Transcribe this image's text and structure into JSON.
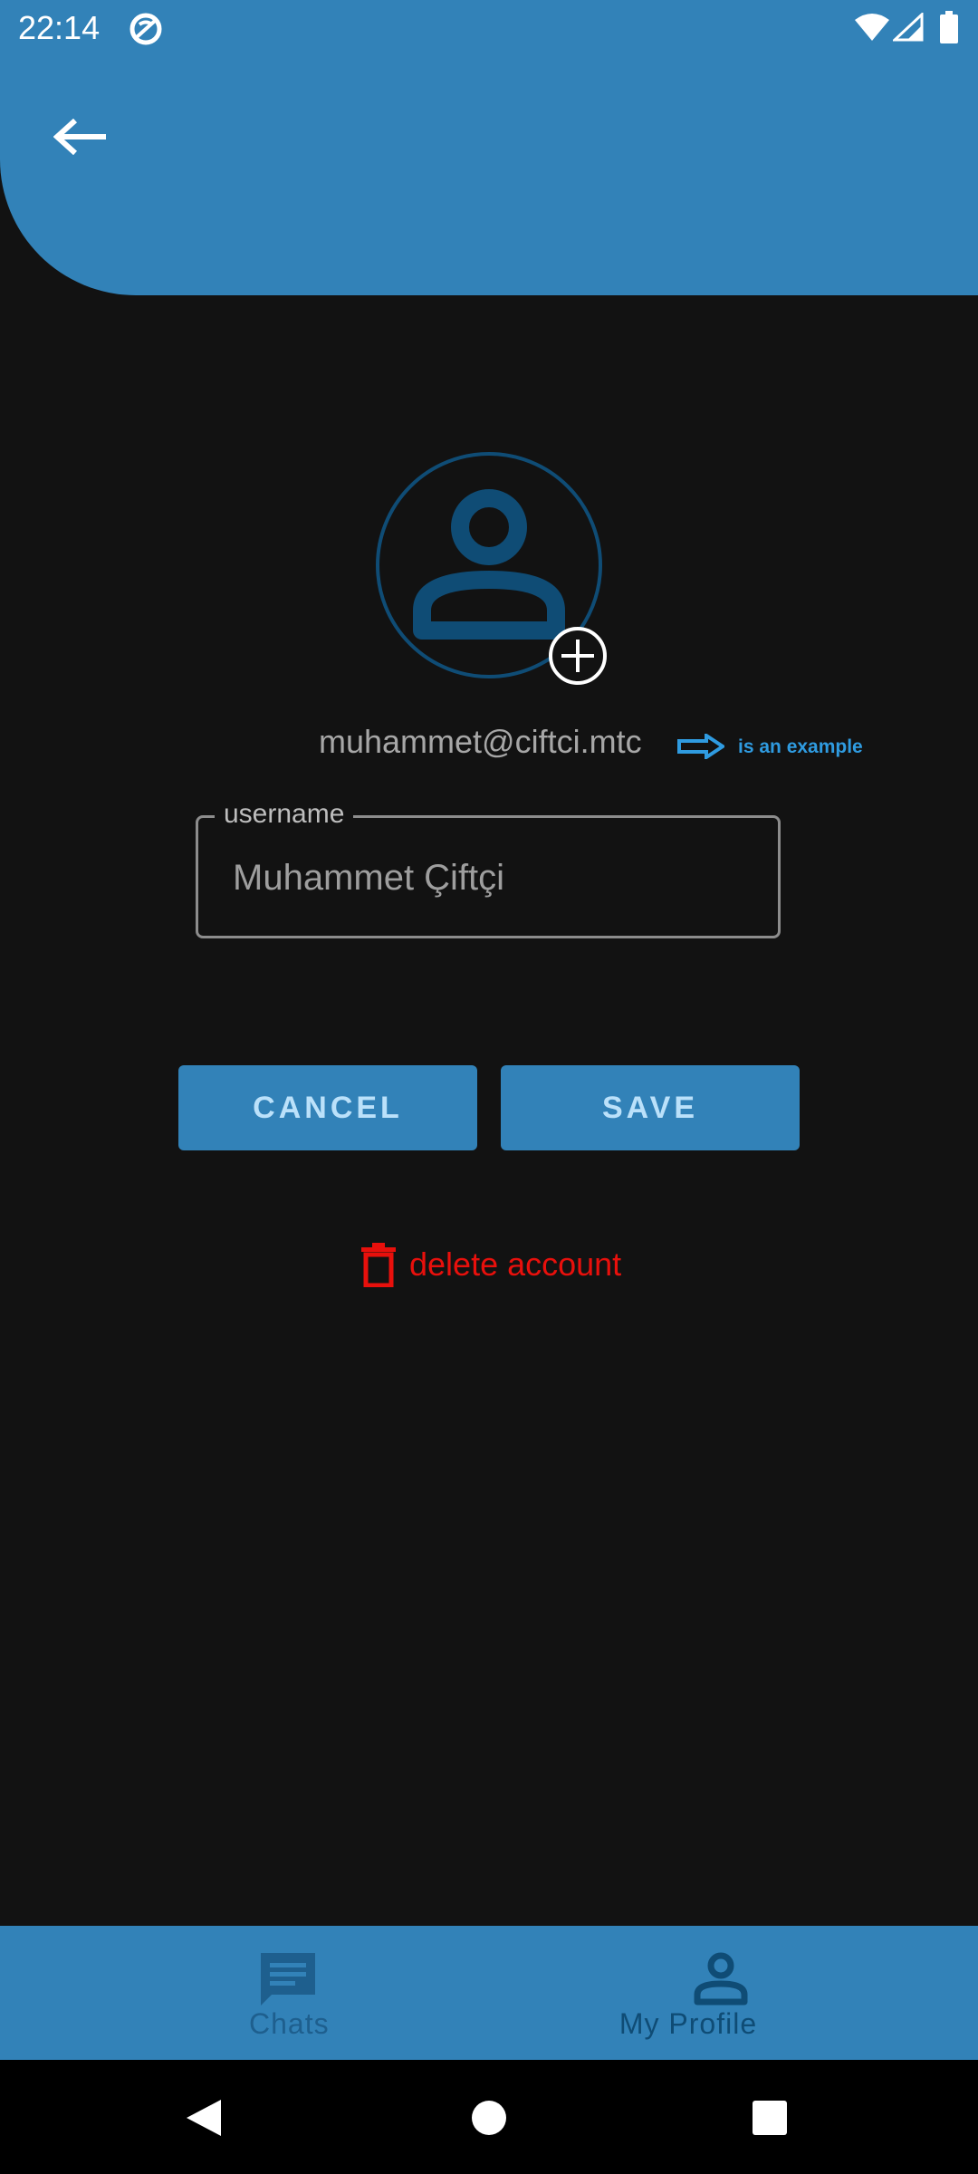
{
  "status_bar": {
    "time": "22:14",
    "icons": [
      "dnd-icon",
      "wifi-icon",
      "signal-icon",
      "battery-icon"
    ]
  },
  "header": {
    "back_icon": "arrow-left-icon",
    "color": "#3282b8"
  },
  "profile": {
    "avatar_icon": "person-outline-icon",
    "add_photo_icon": "add-circle-icon",
    "email": "muhammet@ciftci.mtc",
    "example_note": "is an example",
    "example_arrow_icon": "arrow-right-icon"
  },
  "username_field": {
    "label": "username",
    "value": "Muhammet Çiftçi"
  },
  "buttons": {
    "cancel_label": "CANCEL",
    "save_label": "SAVE"
  },
  "delete": {
    "label": "delete account",
    "icon": "trash-icon",
    "color": "#e8100c"
  },
  "bottom_nav": {
    "items": [
      {
        "label": "Chats",
        "icon": "chat-icon",
        "selected": false
      },
      {
        "label": "My Profile",
        "icon": "person-icon",
        "selected": true
      }
    ]
  },
  "colors": {
    "background": "#121212",
    "accent": "#3282b8",
    "button_text": "#bbe1fa",
    "nav_inactive": "#1e5f8e",
    "nav_active": "#0f4c75",
    "example_note": "#2f9be0"
  }
}
